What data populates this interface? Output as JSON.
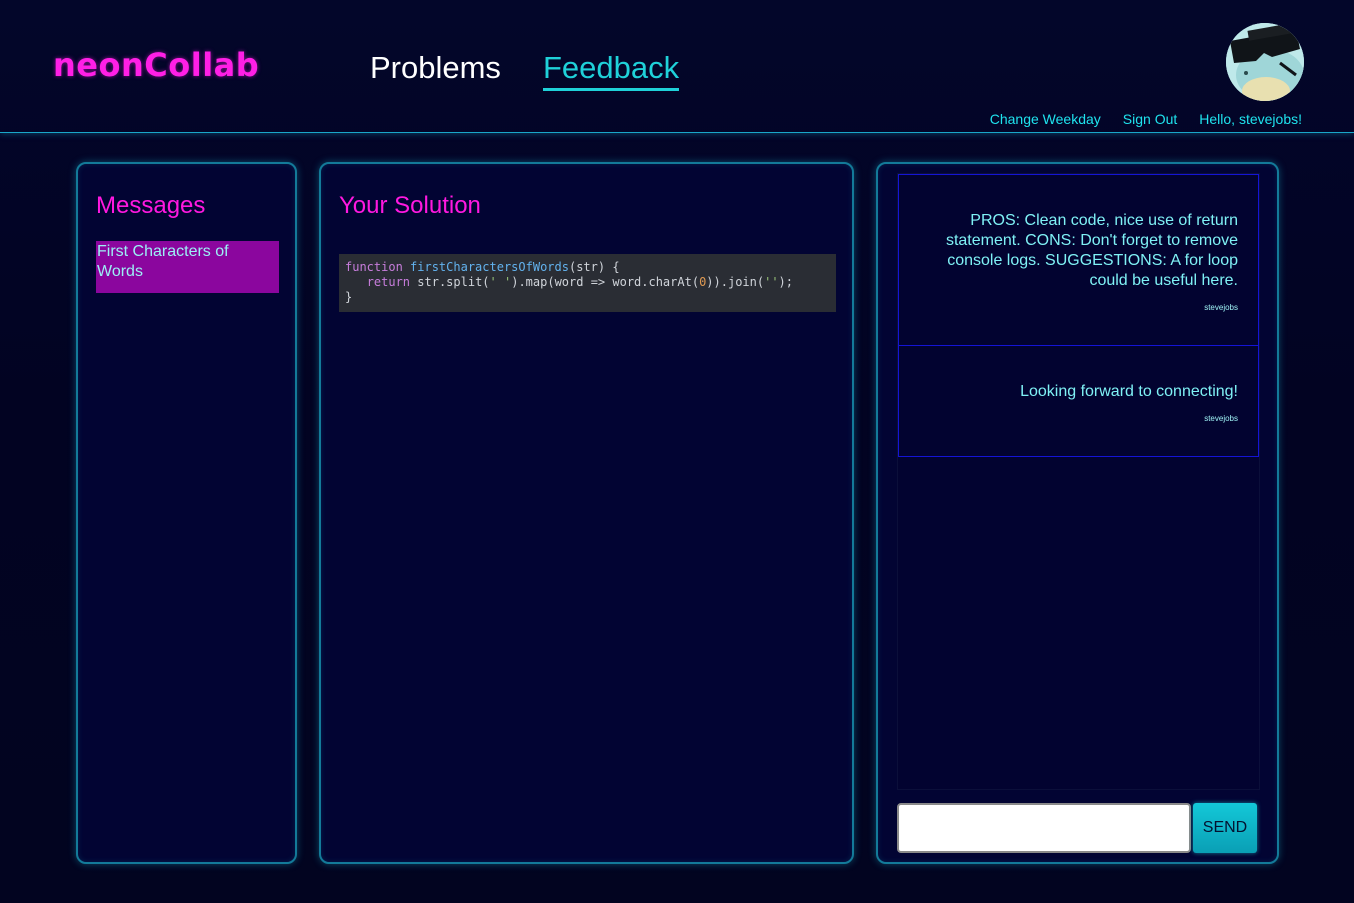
{
  "brand": {
    "name": "neonCollab"
  },
  "nav": {
    "problems": "Problems",
    "feedback": "Feedback"
  },
  "user": {
    "links": [
      "Change Weekday",
      "Sign Out",
      "Hello, stevejobs!"
    ],
    "avatar_icon": "avatar-icon"
  },
  "messages": {
    "title": "Messages",
    "items": [
      {
        "label": "First Characters of Words"
      }
    ]
  },
  "solution": {
    "title": "Your Solution",
    "code": {
      "line1": {
        "kw": "function",
        "fn": "firstCharactersOfWords",
        "rest": "(str) {"
      },
      "line2": {
        "kw": "return",
        "a": " str.split(",
        "s1": "' '",
        "b": ").map(word => word.charAt(",
        "n": "0",
        "c": ")).join(",
        "s2": "''",
        "d": ");"
      },
      "line3": "}"
    }
  },
  "chat": {
    "messages": [
      {
        "text": "PROS: Clean code, nice use of return statement. CONS: Don't forget to remove console logs. SUGGESTIONS: A for loop could be useful here.",
        "author": "stevejobs"
      },
      {
        "text": "Looking forward to connecting!",
        "author": "stevejobs"
      }
    ],
    "input_value": "",
    "send_label": "SEND"
  },
  "colors": {
    "accent_pink": "#ff1fe6",
    "accent_cyan": "#1fd1d9",
    "background": "#02031d",
    "selected_item": "#8b069e"
  }
}
